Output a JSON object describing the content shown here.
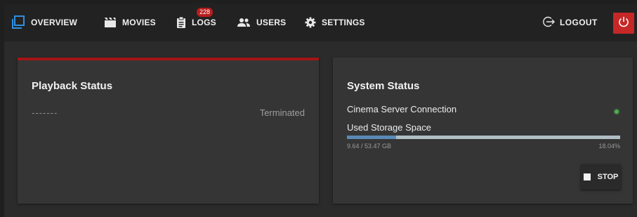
{
  "nav": {
    "overview_label": "OVERVIEW",
    "movies_label": "MOVIES",
    "logs_label": "LOGS",
    "logs_badge": "228",
    "users_label": "USERS",
    "settings_label": "SETTINGS",
    "logout_label": "LOGOUT",
    "power_icon": "power-icon"
  },
  "playback": {
    "title": "Playback Status",
    "placeholder": "-------",
    "state": "Terminated"
  },
  "system": {
    "title": "System Status",
    "connection_label": "Cinema Server Connection",
    "connection_status_color": "#4caf50",
    "storage_label": "Used Storage Space",
    "storage_used_text": "9.64 / 53.47 GB",
    "storage_percent_text": "18.04%",
    "storage_fraction": 0.1804,
    "stop_label": "STOP"
  },
  "colors": {
    "accent_red": "#a31515",
    "badge_red": "#b71c1c",
    "progress_fill": "#5b89b5"
  }
}
